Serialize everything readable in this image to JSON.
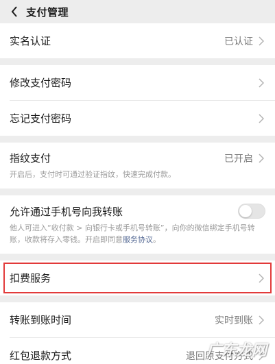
{
  "header": {
    "title": "支付管理",
    "back_icon": "chevron-left-icon"
  },
  "rows": {
    "real_name": {
      "label": "实名认证",
      "value": "已认证"
    },
    "change_pwd": {
      "label": "修改支付密码"
    },
    "forgot_pwd": {
      "label": "忘记支付密码"
    },
    "fingerprint": {
      "label": "指纹支付",
      "value": "已开启",
      "desc": "开启后，支付时可通过验证指纹，快速完成付款。"
    },
    "phone_transfer": {
      "label": "允许通过手机号向我转账",
      "desc": "他人可进入“收付款 > 向银行卡或手机号转账”，向你的微信绑定手机号转账，收款将存入零钱。开启即同意",
      "link": "服务协议",
      "desc_end": "。",
      "enabled": false
    },
    "deduct": {
      "label": "扣费服务"
    },
    "transfer_time": {
      "label": "转账到账时间",
      "value": "实时到账"
    },
    "red_packet": {
      "label": "红包退款方式",
      "value": "退回原支付方式"
    }
  },
  "watermark": "广东龙网",
  "colors": {
    "background": "#ededed",
    "highlight": "#e23a3a",
    "link": "#576b95"
  }
}
